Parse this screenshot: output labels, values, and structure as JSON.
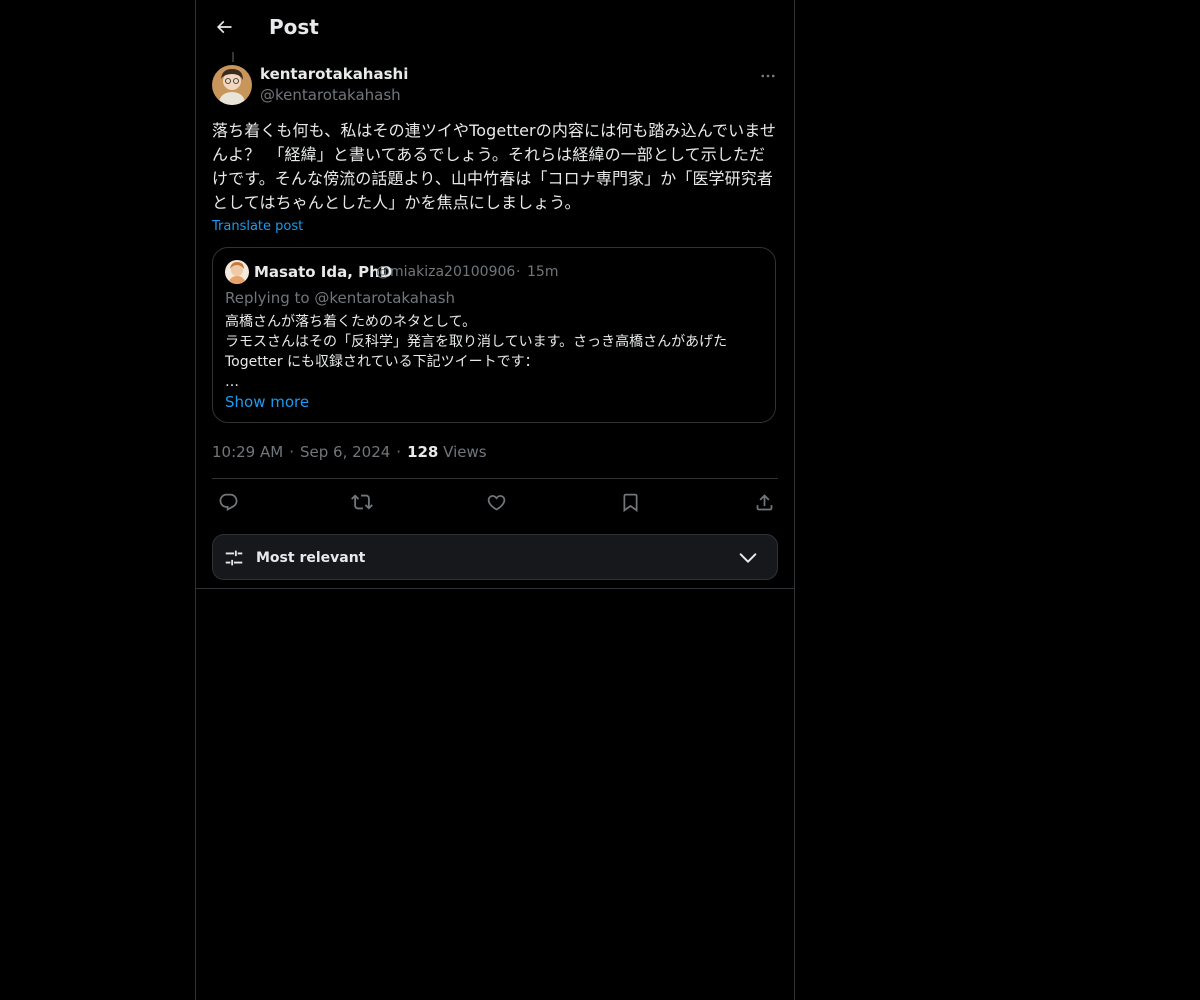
{
  "header": {
    "title": "Post",
    "back_icon": "arrow-left-icon"
  },
  "post": {
    "author": {
      "display_name": "kentarotakahashi",
      "handle": "@kentarotakahash"
    },
    "text": "落ち着くも何も、私はその連ツイやTogetterの内容には何も踏み込んでいませんよ？　「経緯」と書いてあるでしょう。それらは経緯の一部として示しただけです。そんな傍流の話題より、山中竹春は「コロナ専門家」か「医学研究者としてはちゃんとした人」かを焦点にしましょう。",
    "translate_label": "Translate post",
    "quote": {
      "display_name": "Masato Ida, PhD",
      "handle": "@miakiza20100906",
      "separator": "·",
      "time": "15m",
      "replying_to": "Replying to @kentarotakahash",
      "text": "高橋さんが落ち着くためのネタとして。\nラモスさんはその「反科学」発言を取り消しています。さっき高橋さんがあげたTogetter にも収録されている下記ツイートです：\n…",
      "show_more": "Show more"
    },
    "meta": {
      "time": "10:29 AM",
      "date": "Sep 6, 2024",
      "separator": "·",
      "views_count": "128",
      "views_label": "Views"
    },
    "actions": [
      "reply-icon",
      "repost-icon",
      "like-icon",
      "bookmark-icon",
      "share-icon"
    ]
  },
  "sort": {
    "label": "Most relevant",
    "icon": "sliders-icon",
    "chevron": "chevron-down-icon"
  },
  "colors": {
    "background": "#000000",
    "text": "#e7e9ea",
    "secondary": "#71767b",
    "accent": "#1d9bf0",
    "border": "#2f3336"
  }
}
